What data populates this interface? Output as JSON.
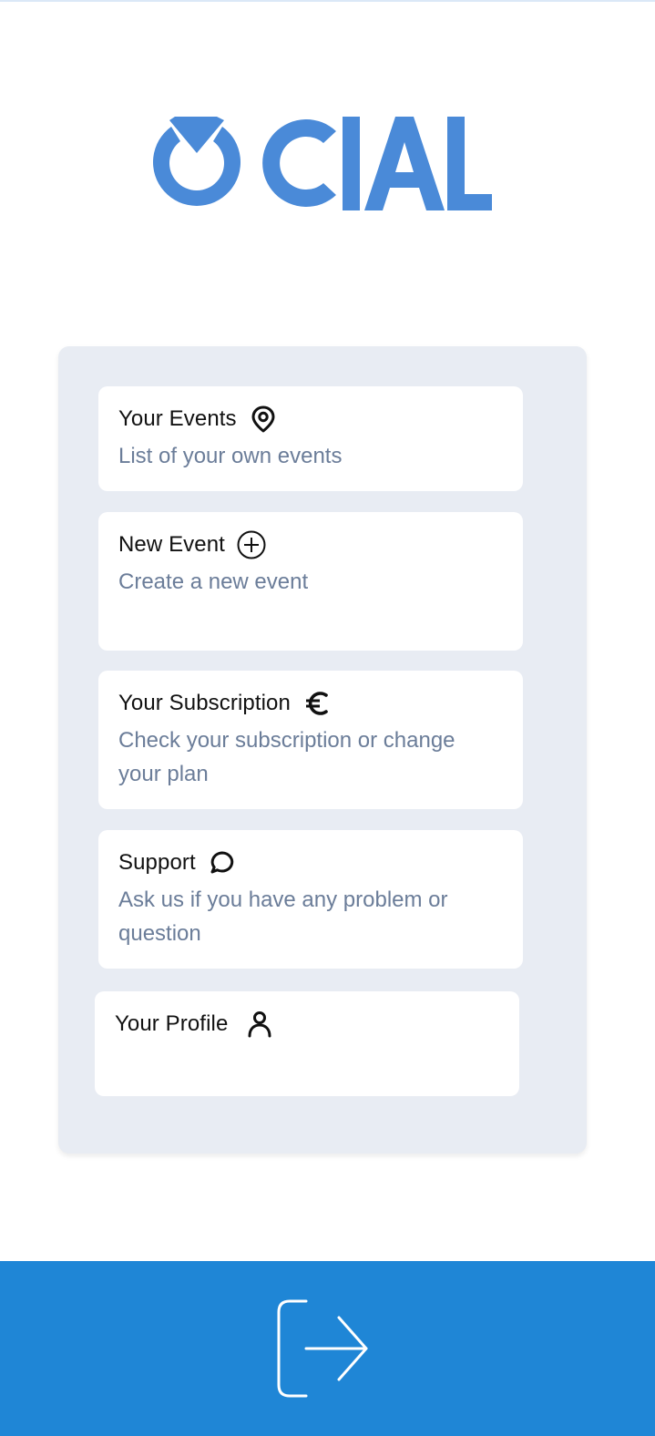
{
  "app": {
    "logo_text": "OCIAL",
    "brand_color": "#4a8ad8",
    "exit_bar_color": "#1f86d6"
  },
  "menu": {
    "items": [
      {
        "title": "Your Events",
        "description": "List of your own events",
        "icon": "location-pin-icon"
      },
      {
        "title": "New Event",
        "description": "Create a new event",
        "icon": "plus-circle-icon"
      },
      {
        "title": "Your Subscription",
        "description": "Check your subscription or change your plan",
        "icon": "euro-icon"
      },
      {
        "title": "Support",
        "description": "Ask us if you have any problem or question",
        "icon": "chat-bubble-icon"
      },
      {
        "title": "Your Profile",
        "description": "",
        "icon": "user-icon"
      }
    ]
  },
  "footer": {
    "exit_icon": "logout-icon"
  }
}
